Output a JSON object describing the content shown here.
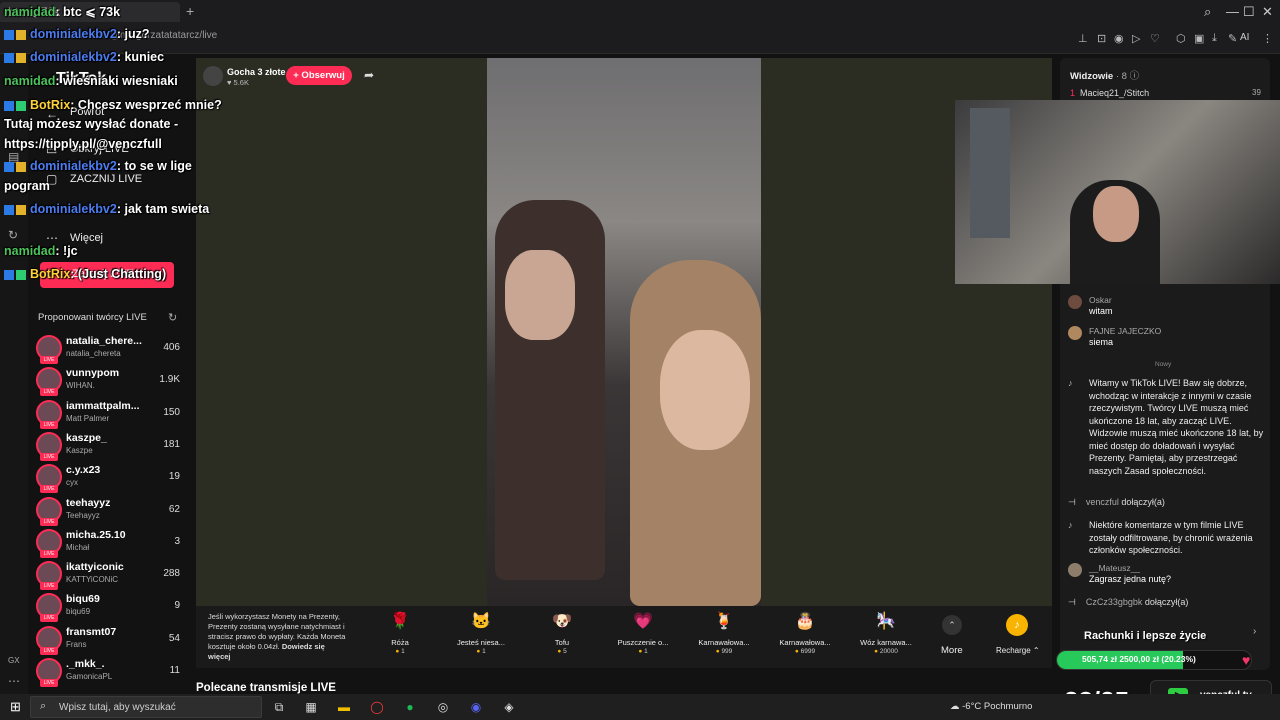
{
  "browser": {
    "tab_title": "btc ⩽ 73k",
    "url": "tiktok.com/@malgorzatatatarcz/live",
    "ai_label": "AI"
  },
  "tiktok_sidebar": {
    "logo": "TikTok",
    "back": "Powrót",
    "follow_live": "Obkryj LIVE",
    "start_live": "ZACZNIJ LIVE",
    "more": "Więcej",
    "start_button": "Zacznij LIVE",
    "suggested_title": "Proponowani twórcy LIVE",
    "creators": [
      {
        "name": "natalia_chere...",
        "sub": "natalia_chereta",
        "count": "406"
      },
      {
        "name": "vunnypom",
        "sub": "WIHAN.",
        "count": "1.9K"
      },
      {
        "name": "iammattpalm...",
        "sub": "Matt Palmer",
        "count": "150"
      },
      {
        "name": "kaszpe_",
        "sub": "Kaszpe",
        "count": "181"
      },
      {
        "name": "c.y.x23",
        "sub": "cyx",
        "count": "19"
      },
      {
        "name": "teehayyz",
        "sub": "Teehayyz",
        "count": "62"
      },
      {
        "name": "micha.25.10",
        "sub": "Michał",
        "count": "3"
      },
      {
        "name": "ikattyiconic",
        "sub": "KATTYiCONiC",
        "count": "288"
      },
      {
        "name": "biqu69",
        "sub": "biqu69",
        "count": "9"
      },
      {
        "name": "fransmt07",
        "sub": "Frans",
        "count": "54"
      },
      {
        "name": "._mkk_.",
        "sub": "GamonicaPL",
        "count": "11"
      }
    ]
  },
  "twitch_chat": [
    {
      "user": "namidad",
      "text": ": btc ⩽ 73k"
    },
    {
      "user": "dominialekbv2",
      "text": ": juz?"
    },
    {
      "user": "dominialekbv2",
      "text": ": kuniec"
    },
    {
      "user": "namidad",
      "text": ": wieśniaki wiesniaki"
    },
    {
      "user": "BotRix",
      "text": ": Chcesz wesprzeć mnie?"
    },
    {
      "user": "",
      "text": "Tutaj możesz wysłać donate -"
    },
    {
      "user": "",
      "text": "https://tipply.pl/@venczfull"
    },
    {
      "user": "dominialekbv2",
      "text": ": to se w lige"
    },
    {
      "user": "",
      "text": "pogram"
    },
    {
      "user": "dominialekbv2",
      "text": ": jak tam swieta"
    },
    {
      "user": "namidad",
      "text": ": !jc"
    },
    {
      "user": "BotRix",
      "text": ": (Just Chatting)"
    }
  ],
  "stream": {
    "streamer_name": "Gocha 3 złote",
    "likes": "5.6K",
    "follow_button": "+ Obserwuj",
    "recommended": "Polecane transmisje LIVE"
  },
  "gift_bar": {
    "note": "Jeśli wykorzystasz Monety na Prezenty, Prezenty zostaną wysyłane natychmiast i stracisz prawo do wypłaty. Każda Moneta kosztuje około 0.04zł.",
    "note_link": "Dowiedz się więcej",
    "gifts": [
      {
        "name": "Róża",
        "price": "1",
        "icon": "rose-icon",
        "glyph": "🌹"
      },
      {
        "name": "Jesteś niesa...",
        "price": "1",
        "icon": "cat-icon",
        "glyph": "🐱"
      },
      {
        "name": "Tofu",
        "price": "5",
        "icon": "dog-icon",
        "glyph": "🐶"
      },
      {
        "name": "Puszczenie o...",
        "price": "1",
        "icon": "heart-icon",
        "glyph": "💗"
      },
      {
        "name": "Karnawałowa...",
        "price": "999",
        "icon": "drink-icon",
        "glyph": "🍹"
      },
      {
        "name": "Karnawałowa...",
        "price": "6999",
        "icon": "cake-icon",
        "glyph": "🎂"
      },
      {
        "name": "Wóz karnawa...",
        "price": "20000",
        "icon": "float-icon",
        "glyph": "🎠"
      }
    ],
    "more": "More",
    "recharge": "Recharge"
  },
  "right_panel": {
    "viewers_title": "Widzowie",
    "viewers_count": "8",
    "top_viewer": "Macieq21_/Stitch",
    "top_viewer_score": "39",
    "comments": [
      {
        "name": "Oskar",
        "text": "witam"
      },
      {
        "name": "FAJNE JAJECZKO",
        "text": "siema"
      }
    ],
    "divider": "Nowy",
    "welcome": "Witamy w TikTok LIVE! Baw się dobrze, wchodząc w interakcje z innymi w czasie rzeczywistym. Twórcy LIVE muszą mieć ukończone 18 lat, aby zacząć LIVE. Widzowie muszą mieć ukończone 18 lat, by mieć dostęp do doładowań i wysyłać Prezenty. Pamiętaj, aby przestrzegać naszych Zasad społeczności.",
    "joined1_name": "venczful",
    "joined_text": "dołączył(a)",
    "filter_note": "Niektóre komentarze w tym filmie LIVE zostały odfiltrowane, by chronić wrażenia członków społeczności.",
    "mateusz_name": "__Mateusz__",
    "mateusz_text": "Zagrasz jedna nutę?",
    "joined2_name": "CzCz33gbgbk"
  },
  "overlay": {
    "goal_title": "Rachunki i lepsze życie",
    "goal_text": "505,74 zł 2500,00 zł (20.23%)",
    "goal_fraction": 0.2023,
    "score": "23/25",
    "channel": "venczful.tv"
  },
  "taskbar": {
    "search_placeholder": "Wpisz tutaj, aby wyszukać",
    "weather": "-6°C  Pochmurno"
  }
}
